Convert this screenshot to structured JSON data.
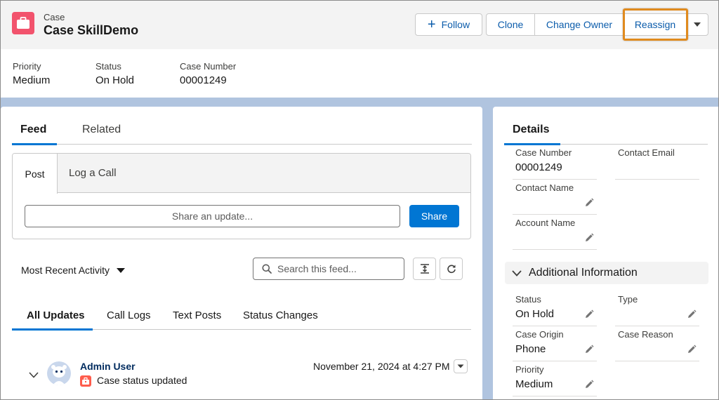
{
  "header": {
    "object_type": "Case",
    "record_title": "Case SkillDemo",
    "buttons": {
      "follow": "Follow",
      "clone": "Clone",
      "change_owner": "Change Owner",
      "reassign": "Reassign"
    }
  },
  "highlights": [
    {
      "label": "Priority",
      "value": "Medium"
    },
    {
      "label": "Status",
      "value": "On Hold"
    },
    {
      "label": "Case Number",
      "value": "00001249"
    }
  ],
  "feed": {
    "tabs": [
      "Feed",
      "Related"
    ],
    "publisher": {
      "tabs": [
        "Post",
        "Log a Call"
      ],
      "placeholder": "Share an update...",
      "share_label": "Share"
    },
    "sort_label": "Most Recent Activity",
    "search_placeholder": "Search this feed...",
    "filter_tabs": [
      "All Updates",
      "Call Logs",
      "Text Posts",
      "Status Changes"
    ],
    "item": {
      "author": "Admin User",
      "text": "Case status updated",
      "date": "November 21, 2024 at 4:27 PM"
    }
  },
  "details": {
    "tab": "Details",
    "fields": {
      "case_number": {
        "label": "Case Number",
        "value": "00001249"
      },
      "contact_email": {
        "label": "Contact Email",
        "value": ""
      },
      "contact_name": {
        "label": "Contact Name",
        "value": ""
      },
      "account_name": {
        "label": "Account Name",
        "value": ""
      }
    },
    "section_title": "Additional Information",
    "additional": {
      "status": {
        "label": "Status",
        "value": "On Hold"
      },
      "type": {
        "label": "Type",
        "value": ""
      },
      "case_origin": {
        "label": "Case Origin",
        "value": "Phone"
      },
      "case_reason": {
        "label": "Case Reason",
        "value": ""
      },
      "priority": {
        "label": "Priority",
        "value": "Medium"
      }
    }
  },
  "colors": {
    "brand": "#0176d3",
    "case_icon": "#f2536d",
    "highlight_outline": "#e08a1e",
    "page_background": "#b0c4df"
  },
  "icons": [
    "briefcase-icon",
    "plus-icon",
    "chevron-down-icon",
    "search-icon",
    "collapse-icon",
    "refresh-icon",
    "pencil-icon",
    "case-status-icon",
    "avatar-icon"
  ]
}
